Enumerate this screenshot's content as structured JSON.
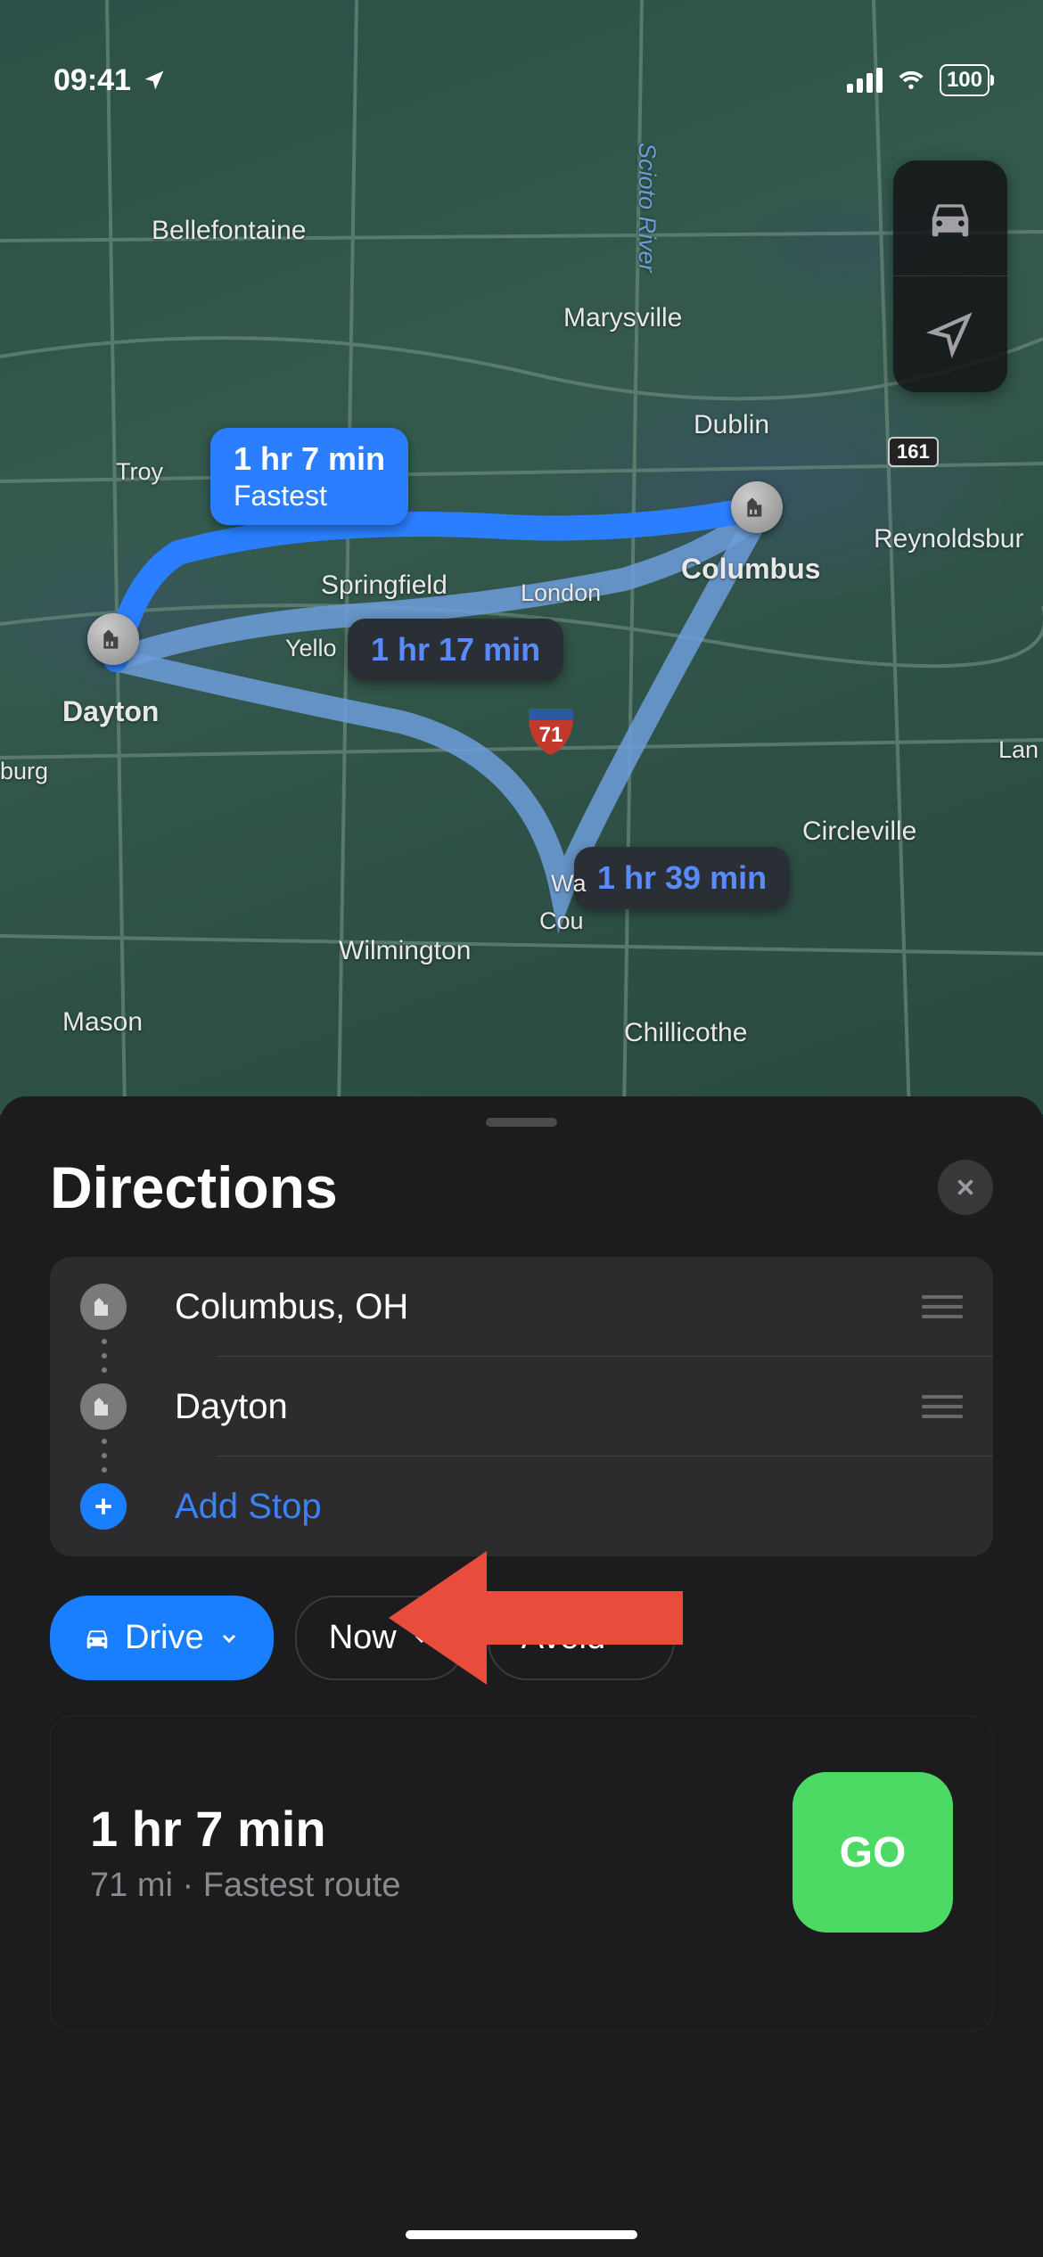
{
  "status_bar": {
    "time": "09:41",
    "battery": "100"
  },
  "map": {
    "cities": {
      "bellefontaine": "Bellefontaine",
      "marysville": "Marysville",
      "dublin": "Dublin",
      "troy": "Troy",
      "columbus": "Columbus",
      "springfield": "Springfield",
      "london": "London",
      "yello": "Yello",
      "dayton": "Dayton",
      "burg": "burg",
      "reynoldsbur": "Reynoldsbur",
      "lan": "Lan",
      "circleville": "Circleville",
      "wa": "Wa",
      "court": "Cou",
      "wilmington": "Wilmington",
      "mason": "Mason",
      "chillicothe": "Chillicothe",
      "scioto": "Scioto River"
    },
    "shield_161": "161",
    "shield_71": "71",
    "routes": {
      "primary": {
        "time": "1 hr 7 min",
        "tag": "Fastest"
      },
      "alt1": {
        "time": "1 hr 17 min"
      },
      "alt2": {
        "time": "1 hr 39 min"
      }
    }
  },
  "sheet": {
    "title": "Directions",
    "stops": [
      {
        "label": "Columbus, OH"
      },
      {
        "label": "Dayton"
      }
    ],
    "add_stop_label": "Add Stop",
    "filters": {
      "drive": "Drive",
      "now": "Now",
      "avoid": "Avoid"
    },
    "selected_route": {
      "time": "1 hr 7 min",
      "distance": "71 mi",
      "description": "Fastest route",
      "go": "GO"
    }
  }
}
